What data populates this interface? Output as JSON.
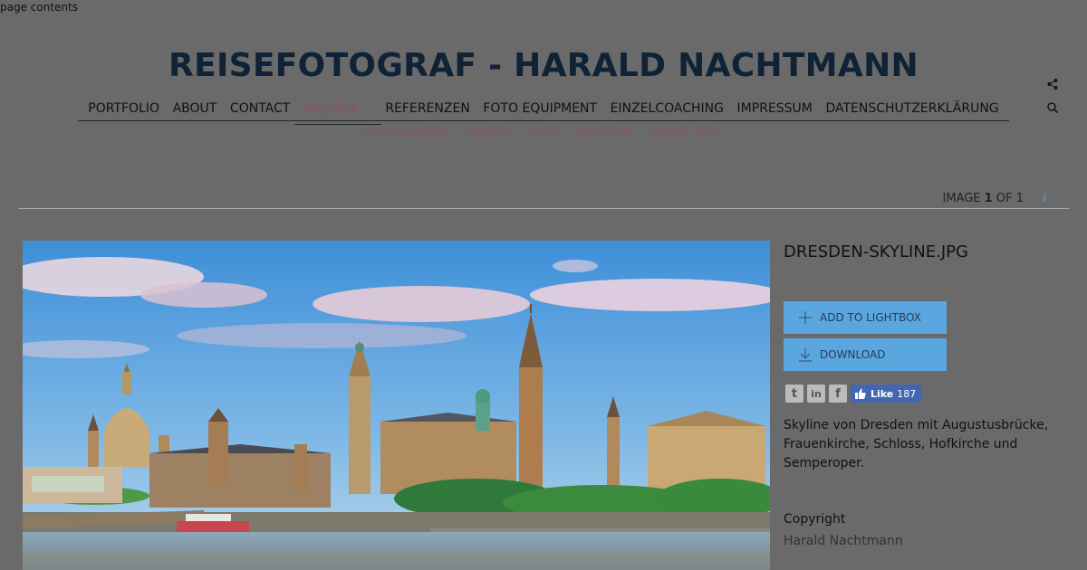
{
  "skip_link": "page contents",
  "site_title": "REISEFOTOGRAF - HARALD NACHTMANN",
  "nav": {
    "items": [
      "PORTFOLIO",
      "ABOUT",
      "CONTACT",
      "ARCHIVE",
      "REFERENZEN",
      "FOTO EQUIPMENT",
      "EINZELCOACHING",
      "IMPRESSUM",
      "DATENSCHUTZERKLÄRUNG"
    ],
    "archive_suffix": "—",
    "active": "ARCHIVE"
  },
  "subnav": {
    "items": [
      "ALL GALLERIES",
      "SEARCH",
      "CART",
      "LIGHTBOX",
      "CLIENT AREA"
    ]
  },
  "counter": {
    "prefix": "IMAGE",
    "current": "1",
    "middle": "OF",
    "total": "1"
  },
  "info_glyph": "i",
  "image": {
    "filename": "DRESDEN-SKYLINE.JPG",
    "caption": "Skyline von Dresden mit Augustusbrücke, Frauenkirche, Schloss, Hofkirche und Semperoper.",
    "copyright_label": "Copyright",
    "copyright_name": "Harald Nachtmann"
  },
  "buttons": {
    "lightbox": "ADD TO LIGHTBOX",
    "download": "DOWNLOAD"
  },
  "social": {
    "twitter": "t",
    "linkedin": "in",
    "facebook": "f",
    "like_label": "Like",
    "like_count": "187"
  },
  "colors": {
    "background": "#6a6a6a",
    "title": "#0f2236",
    "accent_button": "#5aa7df",
    "subnav": "#8a5560",
    "facebook": "#4267b2"
  },
  "icons": [
    "share-icon",
    "search-icon",
    "info-icon",
    "plus-icon",
    "download-icon",
    "twitter-icon",
    "linkedin-icon",
    "facebook-icon",
    "thumbs-up-icon"
  ]
}
